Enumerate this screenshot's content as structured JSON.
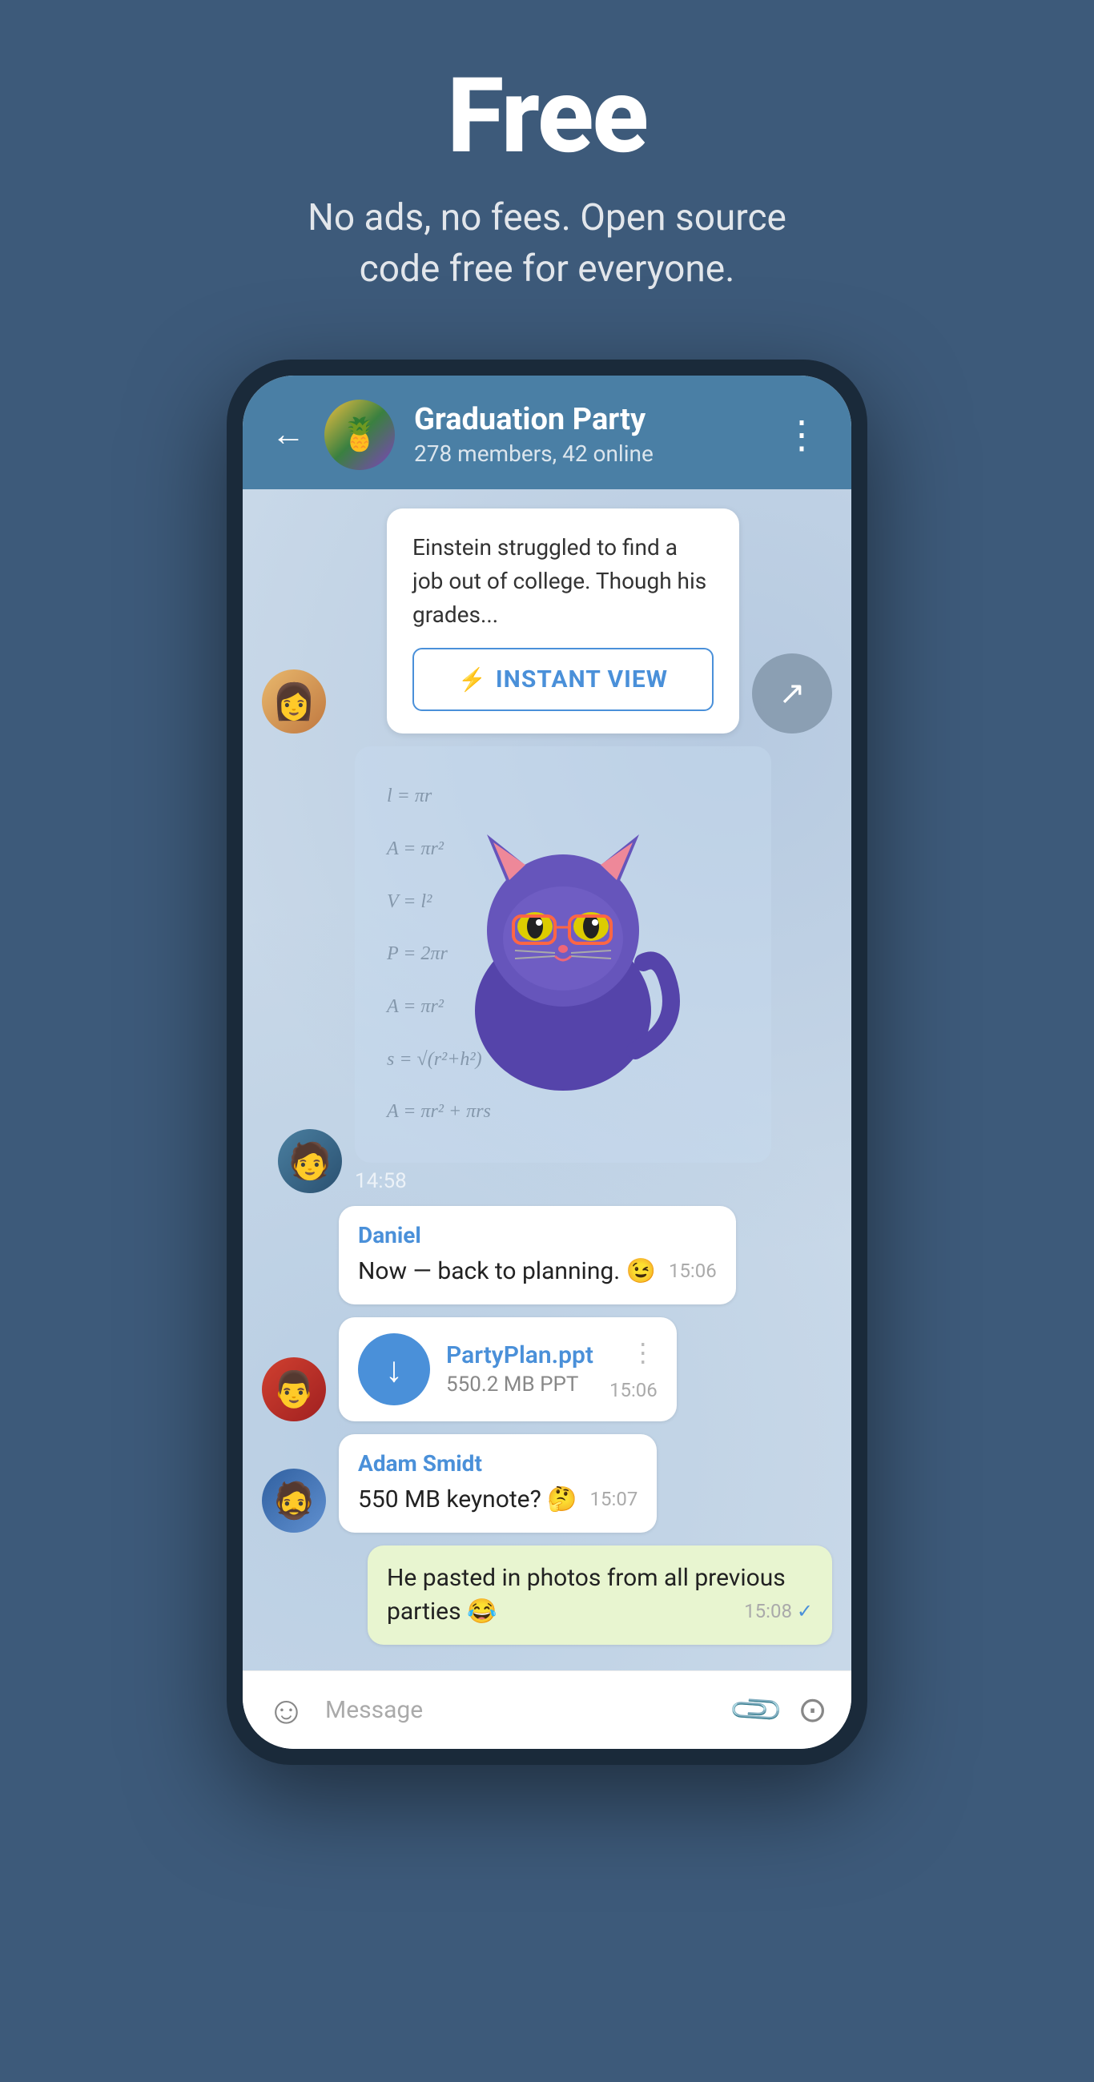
{
  "hero": {
    "title": "Free",
    "subtitle": "No ads, no fees. Open source code free for everyone."
  },
  "phone": {
    "header": {
      "chat_name": "Graduation Party",
      "chat_status": "278 members, 42 online",
      "back_label": "←",
      "more_label": "⋮"
    },
    "messages": [
      {
        "id": "article-preview",
        "type": "article",
        "text": "Einstein struggled to find a job out of college. Though his grades...",
        "instant_view_label": "INSTANT VIEW"
      },
      {
        "id": "sticker-msg",
        "type": "sticker",
        "time": "14:58"
      },
      {
        "id": "daniel-msg",
        "type": "bubble",
        "sender": "Daniel",
        "text": "Now — back to planning. 😉",
        "time": "15:06"
      },
      {
        "id": "file-msg",
        "type": "file",
        "file_name": "PartyPlan.ppt",
        "file_size": "550.2 MB PPT",
        "time": "15:06"
      },
      {
        "id": "adam-msg",
        "type": "bubble",
        "sender": "Adam Smidt",
        "text": "550 MB keynote? 🤔",
        "time": "15:07"
      },
      {
        "id": "own-msg",
        "type": "bubble-own",
        "text": "He pasted in photos from all previous parties 😂",
        "time": "15:08",
        "checked": true
      }
    ],
    "input_bar": {
      "placeholder": "Message",
      "emoji_icon": "☺",
      "attach_icon": "📎",
      "camera_icon": "⊙"
    }
  }
}
